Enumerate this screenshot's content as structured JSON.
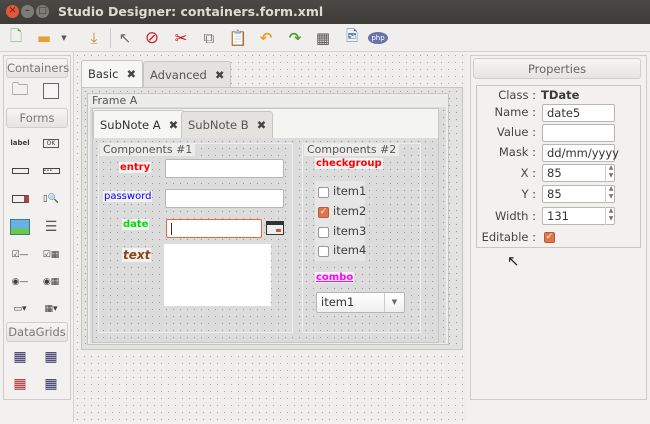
{
  "window": {
    "title": "Studio Designer: containers.form.xml"
  },
  "toolbar": {
    "items": [
      "new-file",
      "open-folder",
      "open-dropdown",
      "save",
      "pointer",
      "stop",
      "cut",
      "copy",
      "paste",
      "undo",
      "redo",
      "calendar",
      "preview",
      "php"
    ]
  },
  "palette": {
    "sections": [
      "Containers",
      "Forms",
      "DataGrids"
    ],
    "label_icon": "label",
    "button_icon": "OK"
  },
  "tabs": [
    {
      "label": "Basic",
      "active": true
    },
    {
      "label": "Advanced",
      "active": false
    }
  ],
  "frame": {
    "title": "Frame A"
  },
  "subtabs": [
    {
      "label": "SubNote A",
      "active": true
    },
    {
      "label": "SubNote B",
      "active": false
    }
  ],
  "components1": {
    "title": "Components #1",
    "entry_label": "entry",
    "password_label": "password",
    "date_label": "date",
    "text_label": "text",
    "colors": {
      "entry": "#ff0000",
      "password": "#0000ff",
      "date": "#00e000",
      "text": "#8b4513"
    }
  },
  "components2": {
    "title": "Components #2",
    "checkgroup_label": "checkgroup",
    "items": [
      {
        "label": "item1",
        "checked": false
      },
      {
        "label": "item2",
        "checked": true
      },
      {
        "label": "item3",
        "checked": false
      },
      {
        "label": "item4",
        "checked": false
      }
    ],
    "combo_label": "combo",
    "combo_value": "item1"
  },
  "properties": {
    "title": "Properties",
    "class_label": "Class :",
    "class_value": "TDate",
    "name_label": "Name :",
    "name_value": "date5",
    "value_label": "Value :",
    "value_value": "",
    "mask_label": "Mask :",
    "mask_value": "dd/mm/yyyy",
    "x_label": "X :",
    "x_value": "85",
    "y_label": "Y :",
    "y_value": "85",
    "width_label": "Width :",
    "width_value": "131",
    "editable_label": "Editable :",
    "editable": true
  }
}
